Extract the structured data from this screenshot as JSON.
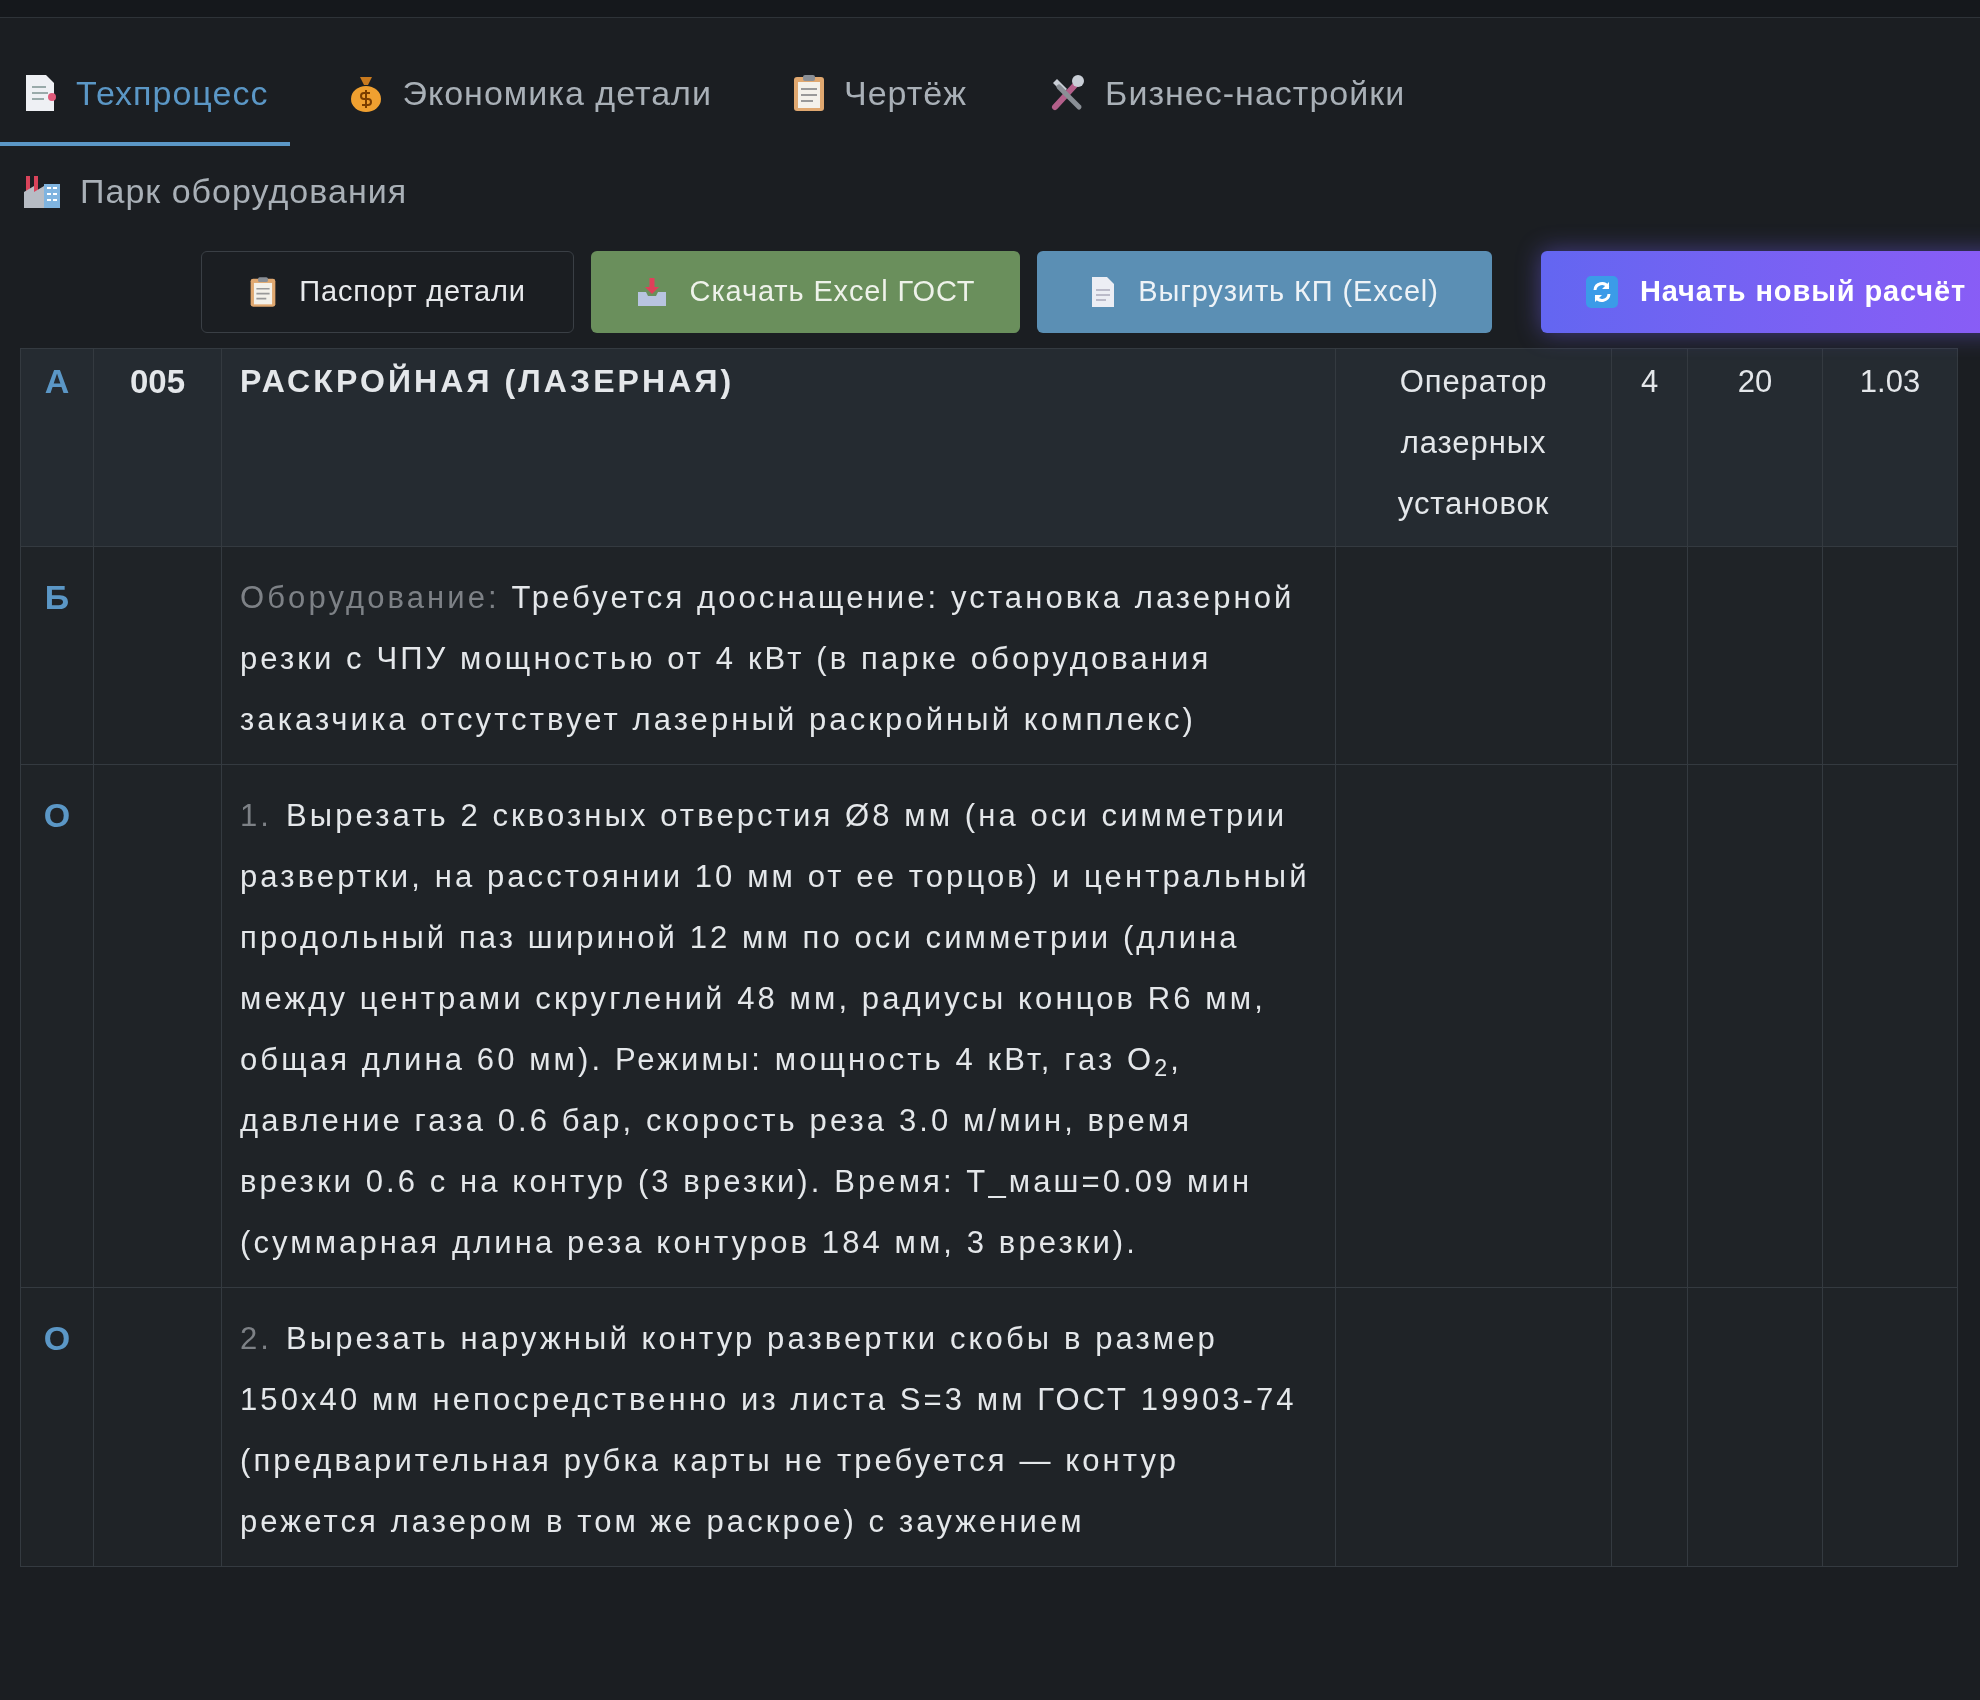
{
  "tabs": [
    {
      "label": "Техпроцесс",
      "selected": true
    },
    {
      "label": "Экономика детали",
      "selected": false
    },
    {
      "label": "Чертёж",
      "selected": false
    },
    {
      "label": "Бизнес-настройки",
      "selected": false
    }
  ],
  "sub_nav": {
    "label": "Парк оборудования"
  },
  "actions": [
    {
      "label": "Паспорт детали",
      "kind": "outline"
    },
    {
      "label": "Скачать Excel ГОСТ",
      "kind": "green"
    },
    {
      "label": "Выгрузить КП (Excel)",
      "kind": "blue"
    },
    {
      "label": "Начать новый расчёт",
      "kind": "accent"
    }
  ],
  "table": {
    "rows": [
      {
        "kind": "operation",
        "marker": "А",
        "number": "005",
        "text": "РАСКРОЙНАЯ (ЛАЗЕРНАЯ)",
        "column_4": "Оператор лазерных установок",
        "column_5": "4",
        "column_6": "20",
        "column_7": "1.03"
      },
      {
        "kind": "equipment",
        "marker": "Б",
        "label": "Оборудование:",
        "text": "Требуется дооснащение: установка лазерной резки с ЧПУ мощностью от 4 кВт (в парке оборудования заказчика отсутствует лазерный раскройный комплекс)"
      },
      {
        "kind": "step",
        "marker": "О",
        "index": "1.",
        "text": "Вырезать 2 сквозных отверстия Ø8 мм (на оси симметрии развертки, на расстоянии 10 мм от ее торцов) и центральный продольный паз шириной 12 мм по оси симметрии (длина между центрами скруглений 48 мм, радиусы концов R6 мм, общая длина 60 мм). Режимы: мощность 4 кВт, газ O$_{2}$, давление газа 0.6 бар, скорость реза 3.0 м/мин, время врезки 0.6 с на контур (3 врезки). Время: T_маш=0.09 мин (суммарная длина реза контуров 184 мм, 3 врезки)."
      },
      {
        "kind": "step",
        "marker": "О",
        "index": "2.",
        "text": "Вырезать наружный контур развертки скобы в размер 150x40 мм непосредственно из листа S=3 мм ГОСТ 19903-74 (предварительная рубка карты не требуется — контур режется лазером в том же раскрое) с заужением"
      }
    ]
  }
}
